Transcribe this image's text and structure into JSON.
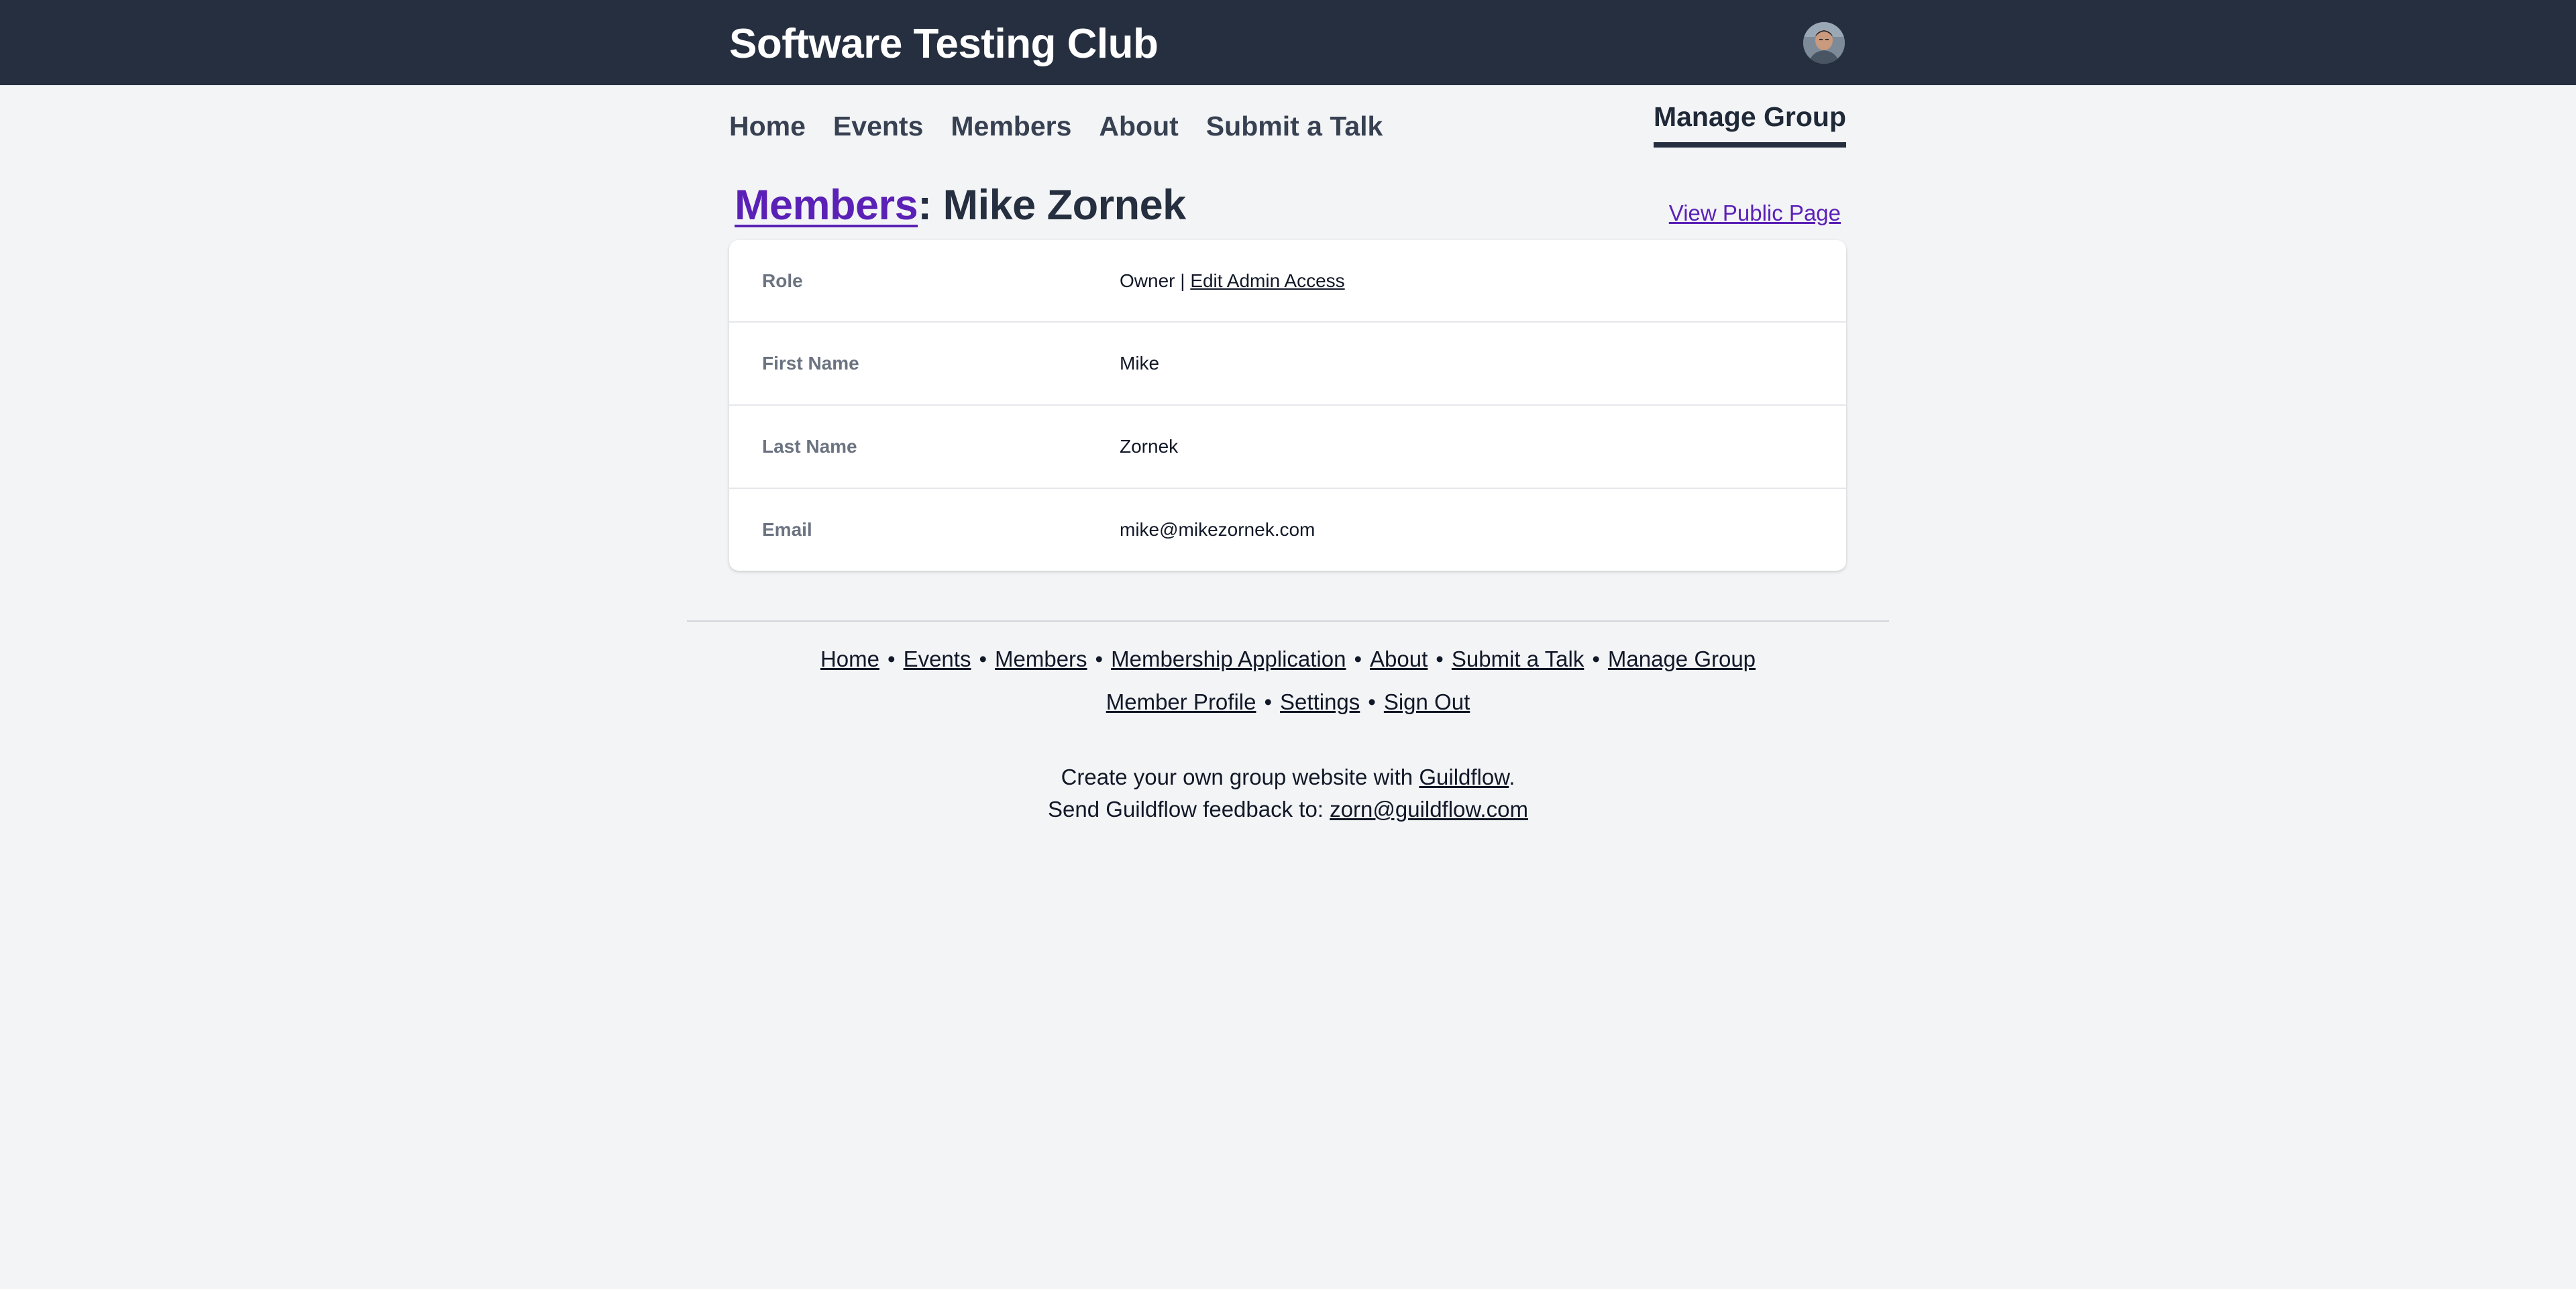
{
  "header": {
    "site_title": "Software Testing Club",
    "avatar_alt": "Mike Zornek"
  },
  "nav": {
    "items": [
      {
        "label": "Home"
      },
      {
        "label": "Events"
      },
      {
        "label": "Members"
      },
      {
        "label": "About"
      },
      {
        "label": "Submit a Talk"
      }
    ],
    "manage_group": "Manage Group"
  },
  "page": {
    "breadcrumb_link": "Members",
    "title_suffix": ": Mike Zornek",
    "view_public_page": "View Public Page"
  },
  "member": {
    "rows": [
      {
        "label": "Role",
        "value": "Owner",
        "separator": " | ",
        "link": "Edit Admin Access"
      },
      {
        "label": "First Name",
        "value": "Mike"
      },
      {
        "label": "Last Name",
        "value": "Zornek"
      },
      {
        "label": "Email",
        "value": "mike@mikezornek.com"
      }
    ]
  },
  "footer": {
    "links_row1": [
      "Home",
      "Events",
      "Members",
      "Membership Application",
      "About",
      "Submit a Talk",
      "Manage Group"
    ],
    "links_row2": [
      "Member Profile",
      "Settings",
      "Sign Out"
    ],
    "bullet": "•",
    "promo_prefix": "Create your own group website with ",
    "promo_link": "Guildflow",
    "promo_suffix": ".",
    "feedback_prefix": "Send Guildflow feedback to: ",
    "feedback_email": "zorn@guildflow.com"
  },
  "colors": {
    "header_bg": "#252f3f",
    "page_bg": "#f3f4f6",
    "link_purple": "#5b21b6"
  }
}
